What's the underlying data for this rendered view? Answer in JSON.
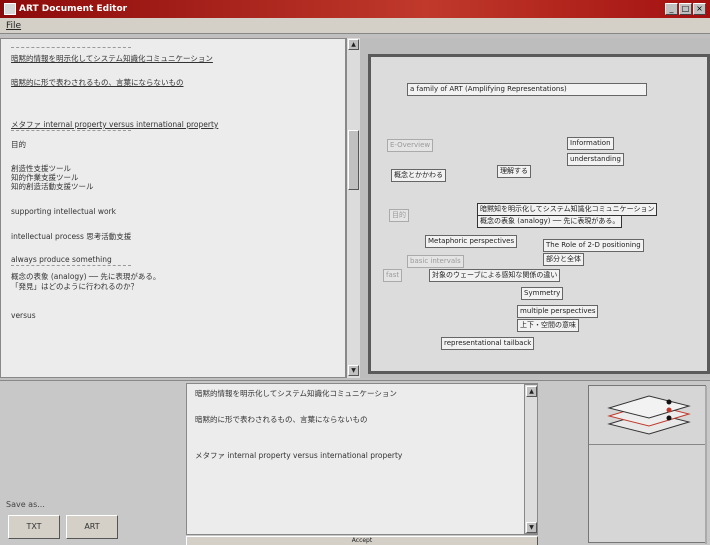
{
  "window": {
    "title": "ART Document Editor"
  },
  "menubar": {
    "file": "File"
  },
  "outline": {
    "lines": [
      "暗黙的情報を明示化してシステム知識化コミュニケーション",
      "暗黙的に形で表わされるもの、言葉にならないもの",
      "メタファ internal property versus international property",
      "目的",
      "創造性支援ツール",
      "知的作業支援ツール",
      "知的創造活動支援ツール",
      "supporting intellectual work",
      "intellectual process 思考活動支援",
      "always produce something",
      "概念の表象 (analogy) ── 先に表現がある。",
      "「発見」はどのように行われるのか？",
      "versus"
    ]
  },
  "canvas": {
    "nodes": [
      "a family of ART (Amplifying Representations)",
      "Information",
      "understanding",
      "E-Overview",
      "概念とかかわる",
      "理解する",
      "目的",
      "暗黙知を明示化してシステム知識化コミュニケーション",
      "概念の表象 (analogy) ── 先に表現がある。",
      "Metaphoric perspectives",
      "The Role of 2-D positioning",
      "部分と全体",
      "basic intervals",
      "fast",
      "対象のウェーブによる感知な関係の違い",
      "Symmetry",
      "multiple perspectives",
      "上下・空間の意味",
      "representational tailback"
    ]
  },
  "editor": {
    "lines": [
      "暗黙的情報を明示化してシステム知識化コミュニケーション",
      "暗黙的に形で表わされるもの、言葉にならないもの",
      "メタファ internal property versus international property"
    ],
    "accept_label": "Accept"
  },
  "save": {
    "label": "Save as...",
    "txt_button": "TXT",
    "art_button": "ART"
  },
  "colors": {
    "titlebar": "#b01515",
    "accent_red": "#c0392b"
  }
}
